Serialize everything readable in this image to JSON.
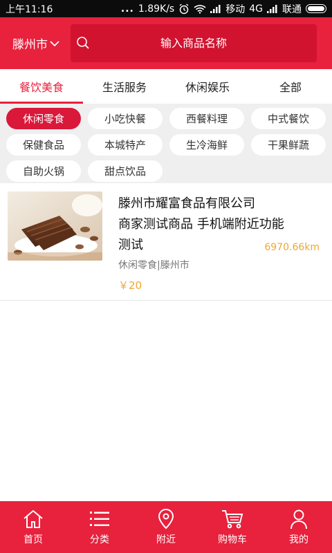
{
  "status_bar": {
    "time": "上午11:16",
    "dots": "...",
    "speed": "1.89K/s",
    "carrier1": "移动",
    "network": "4G",
    "carrier2": "联通"
  },
  "header": {
    "city": "滕州市",
    "search_placeholder": "输入商品名称"
  },
  "tabs": [
    {
      "label": "餐饮美食",
      "active": true
    },
    {
      "label": "生活服务",
      "active": false
    },
    {
      "label": "休闲娱乐",
      "active": false
    },
    {
      "label": "全部",
      "active": false
    }
  ],
  "subcategories": [
    {
      "label": "休闲零食",
      "active": true
    },
    {
      "label": "小吃快餐"
    },
    {
      "label": "西餐料理"
    },
    {
      "label": "中式餐饮"
    },
    {
      "label": "保健食品"
    },
    {
      "label": "本城特产"
    },
    {
      "label": "生冷海鲜"
    },
    {
      "label": "干果鲜蔬"
    },
    {
      "label": "自助火锅"
    },
    {
      "label": "甜点饮品"
    }
  ],
  "products": [
    {
      "title_line1": "滕州市耀富食品有限公司",
      "title_line2": "商家测试商品 手机端附近功能",
      "title_line3": "测试",
      "distance": "6970.66km",
      "category": "休闲零食|滕州市",
      "price": "￥20"
    }
  ],
  "bottom_nav": [
    {
      "label": "首页",
      "icon": "home-icon"
    },
    {
      "label": "分类",
      "icon": "list-icon"
    },
    {
      "label": "附近",
      "icon": "location-icon"
    },
    {
      "label": "购物车",
      "icon": "cart-icon"
    },
    {
      "label": "我的",
      "icon": "user-icon"
    }
  ],
  "colors": {
    "brand_red": "#e8213d",
    "search_bg": "#d11330",
    "price_orange": "#f0a630"
  }
}
